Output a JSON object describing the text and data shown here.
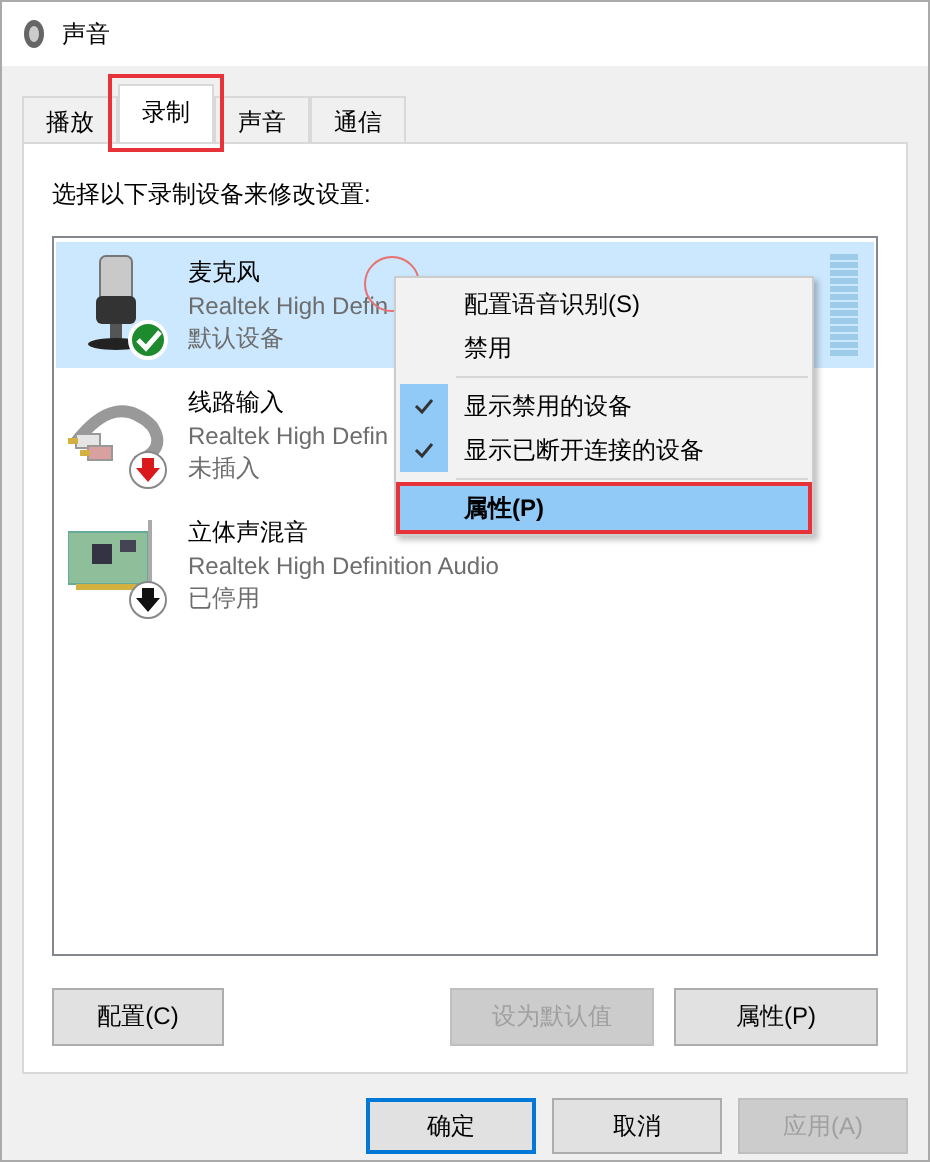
{
  "window": {
    "title": "声音"
  },
  "tabs": [
    {
      "label": "播放",
      "selected": false,
      "annotated": false
    },
    {
      "label": "录制",
      "selected": true,
      "annotated": true
    },
    {
      "label": "声音",
      "selected": false,
      "annotated": false
    },
    {
      "label": "通信",
      "selected": false,
      "annotated": false
    }
  ],
  "instruction": "选择以下录制设备来修改设置:",
  "devices": [
    {
      "name": "麦克风",
      "driver": "Realtek High Defin",
      "status": "默认设备",
      "kind": "microphone",
      "badge": {
        "kind": "check"
      },
      "selected": true
    },
    {
      "name": "线路输入",
      "driver": "Realtek High Defin",
      "status": "未插入",
      "kind": "line-in",
      "badge": {
        "kind": "red-arrow"
      },
      "selected": false
    },
    {
      "name": "立体声混音",
      "driver": "Realtek High Definition Audio",
      "status": "已停用",
      "kind": "sound-card",
      "badge": {
        "kind": "black-arrow"
      },
      "selected": false
    }
  ],
  "context_menu": [
    {
      "kind": "item",
      "label": "配置语音识别(S)",
      "checked": false,
      "selected": false
    },
    {
      "kind": "item",
      "label": "禁用",
      "checked": false,
      "selected": false
    },
    {
      "kind": "separator"
    },
    {
      "kind": "item",
      "label": "显示禁用的设备",
      "checked": true,
      "selected": false
    },
    {
      "kind": "item",
      "label": "显示已断开连接的设备",
      "checked": true,
      "selected": false
    },
    {
      "kind": "separator"
    },
    {
      "kind": "item",
      "label": "属性(P)",
      "checked": false,
      "selected": true
    }
  ],
  "panel_buttons": [
    {
      "label": "配置(C)",
      "disabled": false
    },
    {
      "label": "设为默认值",
      "disabled": true
    },
    {
      "label": "属性(P)",
      "disabled": false
    }
  ],
  "dialog_buttons": [
    {
      "label": "确定",
      "disabled": false
    },
    {
      "label": "取消",
      "disabled": false
    },
    {
      "label": "应用(A)",
      "disabled": true
    }
  ]
}
